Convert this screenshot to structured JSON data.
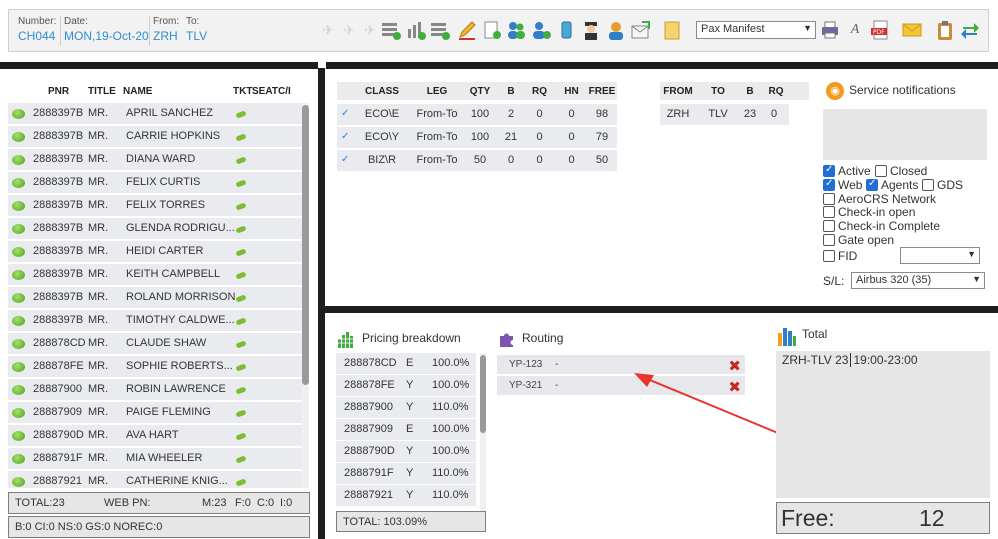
{
  "header": {
    "number_label": "Number:",
    "number_value": "CH044",
    "date_label": "Date:",
    "date_value": "MON,19-Oct-20",
    "from_label": "From:",
    "from_value": "ZRH",
    "to_label": "To:",
    "to_value": "TLV",
    "manifest_select": "Pax Manifest",
    "toolbar_icons": [
      "plane-add-icon",
      "plane-add-icon",
      "plane-add-icon",
      "stack-add-icon",
      "chart-add-icon",
      "stack-down-icon",
      "pencil-icon",
      "document-add-icon",
      "group-icon",
      "user-money-icon",
      "phone-icon",
      "pilot-icon",
      "crew-icon",
      "mail-export-icon",
      "note-icon",
      "printer-icon",
      "text-icon",
      "pdf-icon",
      "envelope-icon",
      "clipboard-icon",
      "refresh-icon"
    ]
  },
  "pax": {
    "headers": [
      "PNR",
      "TITLE",
      "NAME",
      "TKT",
      "SEAT",
      "C/I"
    ],
    "rows": [
      {
        "pnr": "2888397B",
        "title": "MR.",
        "name": "APRIL SANCHEZ"
      },
      {
        "pnr": "2888397B",
        "title": "MR.",
        "name": "CARRIE HOPKINS"
      },
      {
        "pnr": "2888397B",
        "title": "MR.",
        "name": "DIANA WARD"
      },
      {
        "pnr": "2888397B",
        "title": "MR.",
        "name": "FELIX CURTIS"
      },
      {
        "pnr": "2888397B",
        "title": "MR.",
        "name": "FELIX TORRES"
      },
      {
        "pnr": "2888397B",
        "title": "MR.",
        "name": "GLENDA RODRIGU..."
      },
      {
        "pnr": "2888397B",
        "title": "MR.",
        "name": "HEIDI CARTER"
      },
      {
        "pnr": "2888397B",
        "title": "MR.",
        "name": "KEITH CAMPBELL"
      },
      {
        "pnr": "2888397B",
        "title": "MR.",
        "name": "ROLAND MORRISON"
      },
      {
        "pnr": "2888397B",
        "title": "MR.",
        "name": "TIMOTHY CALDWE..."
      },
      {
        "pnr": "288878CD",
        "title": "MR.",
        "name": "CLAUDE SHAW"
      },
      {
        "pnr": "288878FE",
        "title": "MR.",
        "name": "SOPHIE ROBERTS..."
      },
      {
        "pnr": "28887900",
        "title": "MR.",
        "name": "ROBIN LAWRENCE"
      },
      {
        "pnr": "28887909",
        "title": "MR.",
        "name": "PAIGE FLEMING"
      },
      {
        "pnr": "2888790D",
        "title": "MR.",
        "name": "AVA HART"
      },
      {
        "pnr": "2888791F",
        "title": "MR.",
        "name": "MIA WHEELER"
      },
      {
        "pnr": "28887921",
        "title": "MR.",
        "name": "CATHERINE KNIG..."
      }
    ],
    "summary": {
      "total": "TOTAL:23",
      "web": "WEB PN:",
      "m": "M:23",
      "f": "F:0",
      "c": "C:0",
      "i": "I:0"
    },
    "summary2": "B:0 CI:0 NS:0 GS:0 NOREC:0"
  },
  "classes": {
    "headers": [
      "CLASS",
      "LEG",
      "QTY",
      "B",
      "RQ",
      "HN",
      "FREE"
    ],
    "rows": [
      {
        "class": "ECO\\E",
        "leg": "From-To",
        "qty": "100",
        "b": "2",
        "rq": "0",
        "hn": "0",
        "free": "98"
      },
      {
        "class": "ECO\\Y",
        "leg": "From-To",
        "qty": "100",
        "b": "21",
        "rq": "0",
        "hn": "0",
        "free": "79"
      },
      {
        "class": "BIZ\\R",
        "leg": "From-To",
        "qty": "50",
        "b": "0",
        "rq": "0",
        "hn": "0",
        "free": "50"
      }
    ]
  },
  "legs": {
    "headers": [
      "FROM",
      "TO",
      "B",
      "RQ"
    ],
    "rows": [
      {
        "from": "ZRH",
        "to": "TLV",
        "b": "23",
        "rq": "0"
      }
    ]
  },
  "notifications": {
    "title": "Service notifications",
    "active": "Active",
    "closed": "Closed",
    "web": "Web",
    "agents": "Agents",
    "gds": "GDS",
    "aerocrs": "AeroCRS Network",
    "checkin_open": "Check-in open",
    "checkin_complete": "Check-in Complete",
    "gate_open": "Gate open",
    "fid": "FID",
    "sl_label": "S/L:",
    "sl_value": "Airbus 320 (35)"
  },
  "pricing": {
    "title": "Pricing breakdown",
    "rows": [
      {
        "pnr": "288878CD",
        "cls": "E",
        "pct": "100.0%"
      },
      {
        "pnr": "288878FE",
        "cls": "Y",
        "pct": "100.0%"
      },
      {
        "pnr": "28887900",
        "cls": "Y",
        "pct": "110.0%"
      },
      {
        "pnr": "28887909",
        "cls": "E",
        "pct": "100.0%"
      },
      {
        "pnr": "2888790D",
        "cls": "Y",
        "pct": "100.0%"
      },
      {
        "pnr": "2888791F",
        "cls": "Y",
        "pct": "110.0%"
      },
      {
        "pnr": "28887921",
        "cls": "Y",
        "pct": "110.0%"
      }
    ],
    "total": "TOTAL:  103.09%"
  },
  "routing": {
    "title": "Routing",
    "rows": [
      {
        "code": "YP-123",
        "dash": "-"
      },
      {
        "code": "YP-321",
        "dash": "-"
      }
    ]
  },
  "total_panel": {
    "title": "Total",
    "route": "ZRH-TLV 23",
    "time": "19:00-23:00",
    "free_label": "Free:",
    "free_value": "12"
  }
}
